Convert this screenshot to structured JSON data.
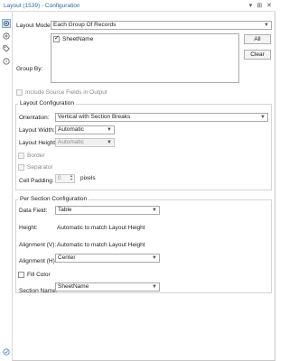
{
  "window": {
    "title": "Layout (1539) - Configuration",
    "buttons": [
      "▾",
      "⊞",
      "✕"
    ]
  },
  "layout": {
    "mode_label": "Layout Mode:",
    "mode_value": "Each Group Of Records",
    "group_by_label": "Group By:",
    "group_by_items": [
      {
        "label": "SheetName",
        "checked": true
      }
    ],
    "all_button": "All",
    "clear_button": "Clear",
    "include_source_label": "Include Source Fields in Output"
  },
  "layout_config": {
    "title": "Layout Configuration",
    "orientation_label": "Orientation:",
    "orientation_value": "Vertical with Section Breaks",
    "width_label": "Layout Width:",
    "width_value": "Automatic",
    "height_label": "Layout Height:",
    "height_value": "Automatic",
    "border_label": "Border",
    "separator_label": "Separator",
    "padding_label": "Cell Padding:",
    "padding_value": "0",
    "padding_unit": "pixels"
  },
  "section_config": {
    "title": "Per Section Configuration",
    "data_field_label": "Data Field:",
    "data_field_value": "Table",
    "height_label": "Height:",
    "height_value": "Automatic to match Layout Height",
    "align_v_label": "Alignment (V):",
    "align_v_value": "Automatic to match Layout Height",
    "align_h_label": "Alignment (H):",
    "align_h_value": "Center",
    "fill_color_label": "Fill Color",
    "section_name_label": "Section Name:",
    "section_name_value": "SheetName"
  },
  "rail": {
    "icons": [
      "gear-icon",
      "arrows-icon",
      "tag-icon",
      "help-icon"
    ]
  },
  "colors": {
    "title_text": "#2d6aa6",
    "selected_rail": "#cfe3f7"
  }
}
